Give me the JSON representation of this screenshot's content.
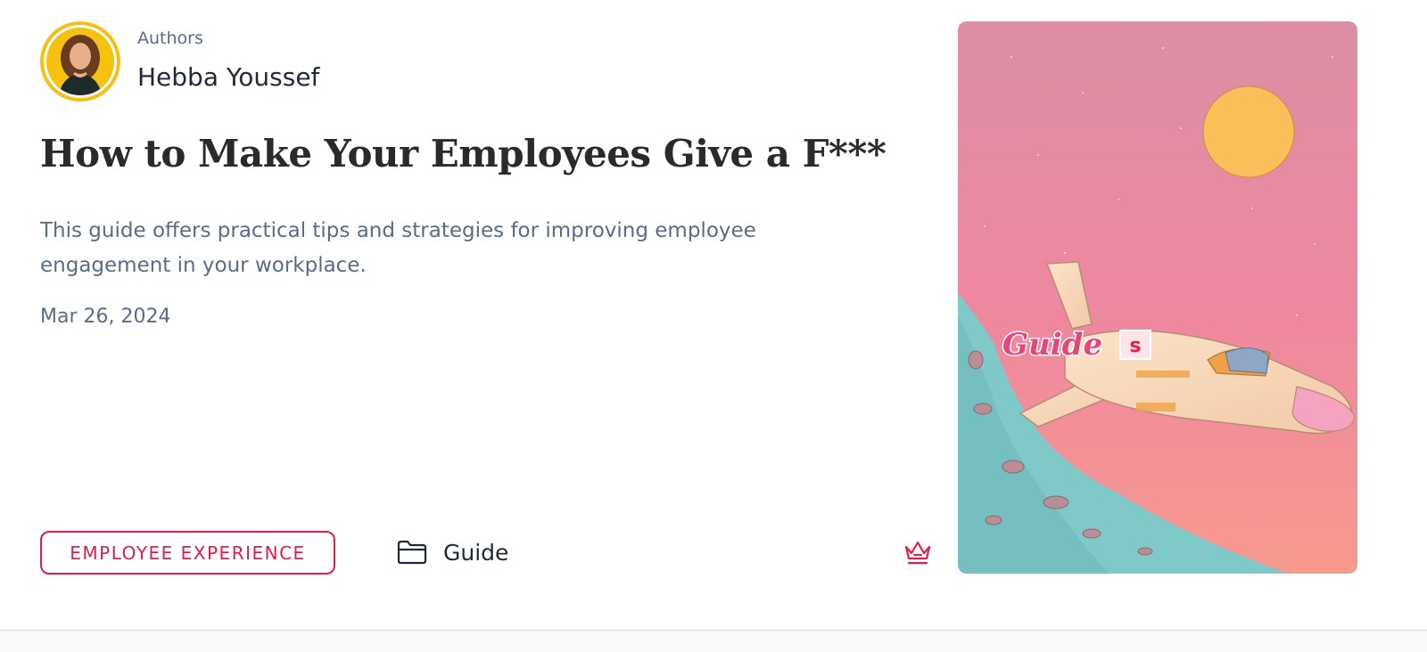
{
  "author_block": {
    "heading": "Authors",
    "name": "Hebba Youssef"
  },
  "article": {
    "title": "How to Make Your Employees Give a F***",
    "description": "This guide offers practical tips and strategies for improving employee engagement in your workplace.",
    "date": "Mar 26, 2024"
  },
  "footer": {
    "tag": "EMPLOYEE EXPERIENCE",
    "category": "Guide",
    "category_icon": "folder-icon",
    "premium_icon": "crown-icon"
  },
  "cover_image": {
    "label": "Guide",
    "badge": "s"
  },
  "colors": {
    "accent": "#e11d48",
    "avatar_ring": "#f6bf16",
    "muted_text": "#5a6b85"
  }
}
